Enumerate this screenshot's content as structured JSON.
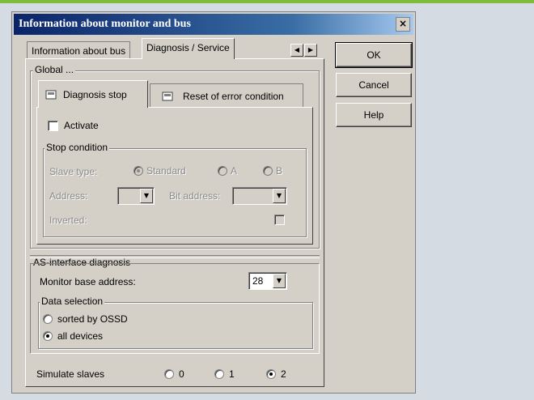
{
  "window": {
    "title": "Information about monitor and bus",
    "close_glyph": "×"
  },
  "tabs": {
    "bus_info": "Information about bus",
    "diag_service": "Diagnosis / Service"
  },
  "global": {
    "label": "Global ...",
    "subtabs": {
      "diag_stop": "Diagnosis stop",
      "reset_error": "Reset of error condition"
    },
    "activate_label": "Activate",
    "stop_condition": {
      "label": "Stop condition",
      "slave_type_label": "Slave type:",
      "standard": "Standard",
      "a": "A",
      "b": "B",
      "address_label": "Address:",
      "bit_address_label": "Bit address:",
      "inverted_label": "Inverted:"
    }
  },
  "as_diag": {
    "label": "AS-interface diagnosis",
    "monitor_base_label": "Monitor base address:",
    "monitor_base_value": "28",
    "data_selection": {
      "label": "Data selection",
      "sorted": "sorted by OSSD",
      "all": "all devices",
      "selected": "all"
    }
  },
  "simulate": {
    "label": "Simulate slaves",
    "options": [
      "0",
      "1",
      "2"
    ],
    "selected": "2"
  },
  "buttons": {
    "ok": "OK",
    "cancel": "Cancel",
    "help": "Help"
  }
}
